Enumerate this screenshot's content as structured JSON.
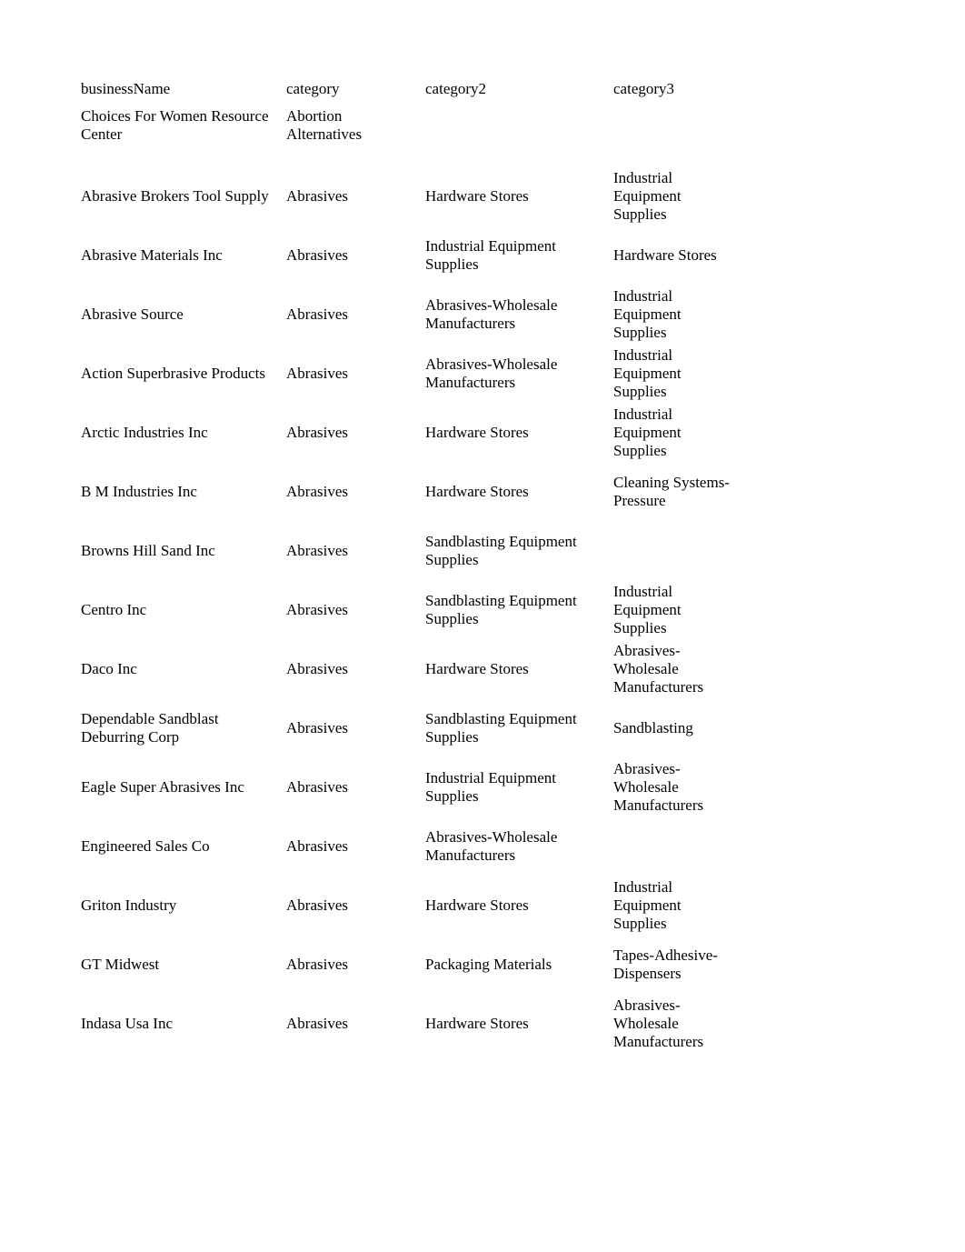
{
  "document": {
    "type": "table",
    "background_color": "#ffffff",
    "text_color": "#000000"
  },
  "table": {
    "headers": [
      "businessName",
      "category",
      "category2",
      "category3"
    ],
    "rows": [
      {
        "businessName": "Choices For Women Resource Center",
        "category": "Abortion Alternatives",
        "category2": "",
        "category3": ""
      },
      {
        "businessName": "Abrasive Brokers Tool Supply",
        "category": "Abrasives",
        "category2": "Hardware Stores",
        "category3": "Industrial Equipment Supplies"
      },
      {
        "businessName": "Abrasive Materials Inc",
        "category": "Abrasives",
        "category2": "Industrial Equipment Supplies",
        "category3": "Hardware Stores"
      },
      {
        "businessName": "Abrasive Source",
        "category": "Abrasives",
        "category2": "Abrasives-Wholesale Manufacturers",
        "category3": "Industrial Equipment Supplies"
      },
      {
        "businessName": "Action Superbrasive Products",
        "category": "Abrasives",
        "category2": "Abrasives-Wholesale Manufacturers",
        "category3": "Industrial Equipment Supplies"
      },
      {
        "businessName": "Arctic Industries Inc",
        "category": "Abrasives",
        "category2": "Hardware Stores",
        "category3": "Industrial Equipment Supplies"
      },
      {
        "businessName": "B M Industries Inc",
        "category": "Abrasives",
        "category2": "Hardware Stores",
        "category3": "Cleaning Systems-Pressure"
      },
      {
        "businessName": "Browns Hill Sand Inc",
        "category": "Abrasives",
        "category2": "Sandblasting Equipment Supplies",
        "category3": ""
      },
      {
        "businessName": "Centro Inc",
        "category": "Abrasives",
        "category2": "Sandblasting Equipment Supplies",
        "category3": "Industrial Equipment Supplies"
      },
      {
        "businessName": "Daco Inc",
        "category": "Abrasives",
        "category2": "Hardware Stores",
        "category3": "Abrasives-Wholesale Manufacturers"
      },
      {
        "businessName": "Dependable Sandblast Deburring Corp",
        "category": "Abrasives",
        "category2": "Sandblasting Equipment Supplies",
        "category3": "Sandblasting"
      },
      {
        "businessName": "Eagle Super Abrasives Inc",
        "category": "Abrasives",
        "category2": "Industrial Equipment Supplies",
        "category3": "Abrasives-Wholesale Manufacturers"
      },
      {
        "businessName": "Engineered Sales Co",
        "category": "Abrasives",
        "category2": "Abrasives-Wholesale Manufacturers",
        "category3": ""
      },
      {
        "businessName": "Griton Industry",
        "category": "Abrasives",
        "category2": "Hardware Stores",
        "category3": "Industrial Equipment Supplies"
      },
      {
        "businessName": "GT Midwest",
        "category": "Abrasives",
        "category2": "Packaging Materials",
        "category3": "Tapes-Adhesive-Dispensers"
      },
      {
        "businessName": "Indasa Usa Inc",
        "category": "Abrasives",
        "category2": "Hardware Stores",
        "category3": "Abrasives-Wholesale Manufacturers"
      }
    ]
  }
}
